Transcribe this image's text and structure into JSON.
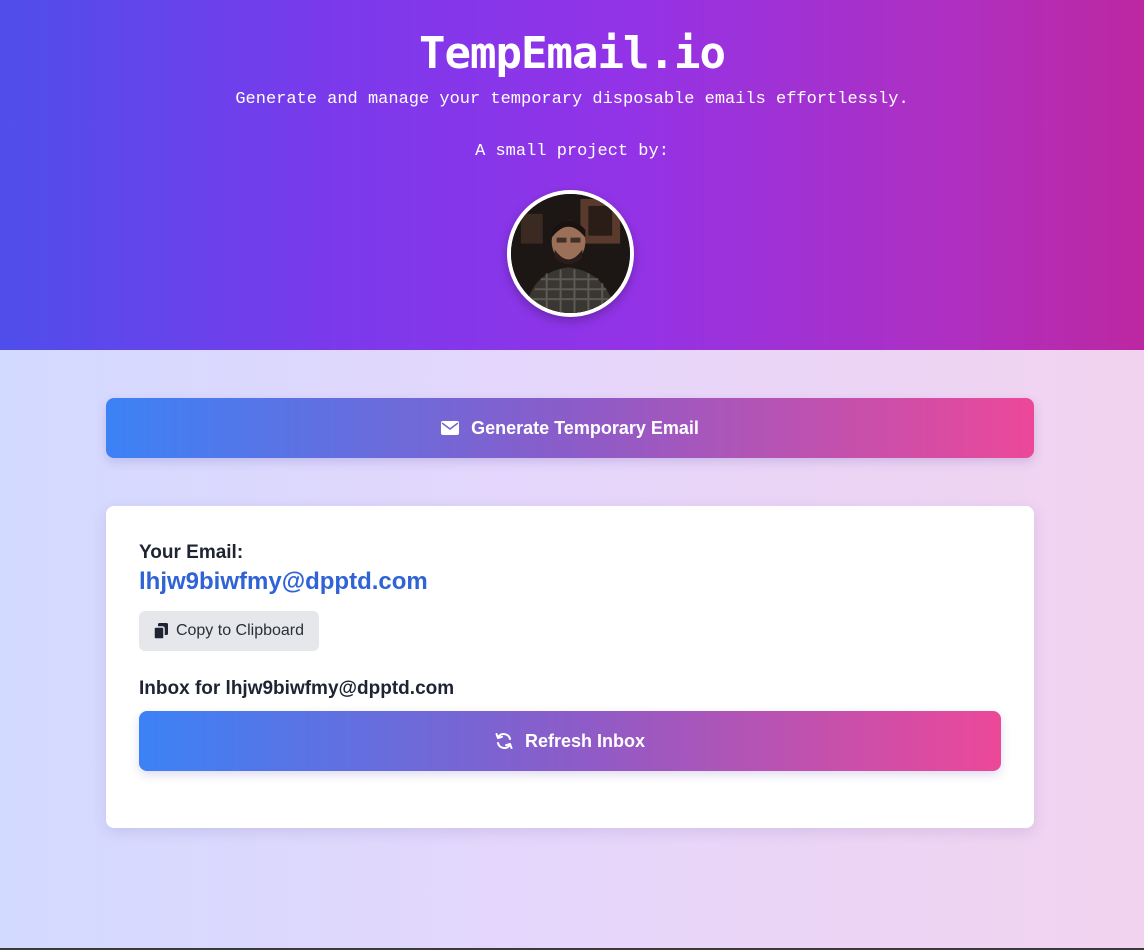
{
  "hero": {
    "title": "TempEmail.io",
    "subtitle": "Generate and manage your temporary disposable emails effortlessly.",
    "byline": "A small project by:",
    "avatar_icon": "author-avatar-photo"
  },
  "actions": {
    "generate_label": "Generate Temporary Email",
    "generate_icon": "envelope-icon"
  },
  "email_card": {
    "email_label": "Your Email:",
    "email_value": "lhjw9biwfmy@dpptd.com",
    "copy_label": "Copy to Clipboard",
    "copy_icon": "copy-icon",
    "inbox_label": "Inbox for lhjw9biwfmy@dpptd.com",
    "refresh_label": "Refresh Inbox",
    "refresh_icon": "refresh-icon"
  },
  "colors": {
    "hero_start": "#4f4eea",
    "hero_end": "#bd27a1",
    "button_start": "#3b82f6",
    "button_end": "#ec4899",
    "email_link": "#2f63d6"
  }
}
